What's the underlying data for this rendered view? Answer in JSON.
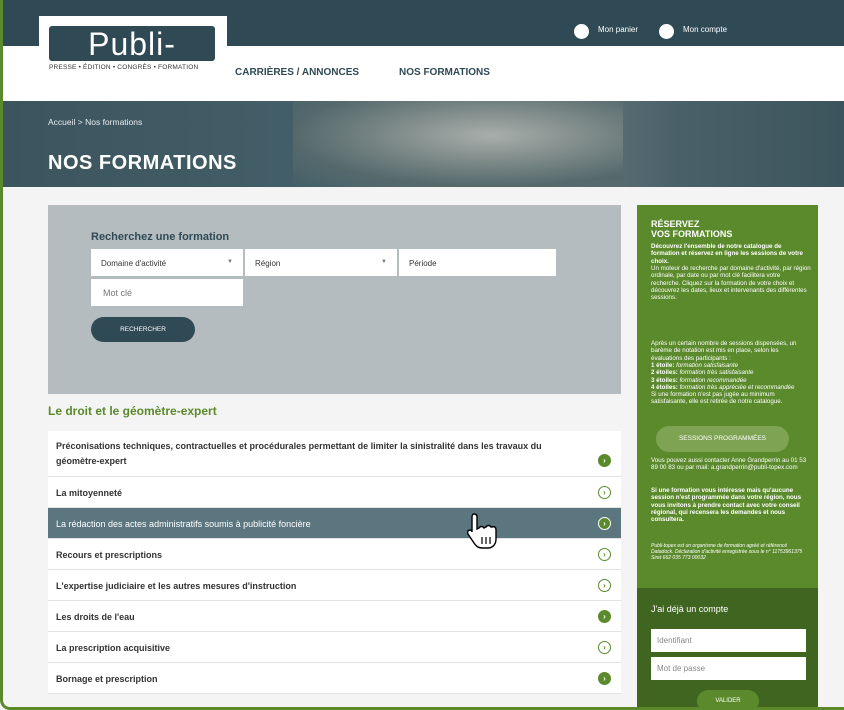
{
  "brand": {
    "logo_text": "Publi-Topex",
    "logo_tagline": "PRESSE • ÉDITION • CONGRÈS • FORMATION"
  },
  "topbar": {
    "cart_label": "Mon panier",
    "account_label": "Mon compte"
  },
  "nav": {
    "item1": "CARRIÈRES / ANNONCES",
    "item2": "NOS FORMATIONS"
  },
  "hero": {
    "breadcrumb": "Accueil > Nos formations",
    "title": "NOS FORMATIONS"
  },
  "search": {
    "title": "Recherchez une formation",
    "domain_select": "Domaine d'activité",
    "region_select": "Région",
    "period_input": "Période",
    "keyword_placeholder": "Mot clé",
    "button": "RECHERCHER"
  },
  "section_title": "Le droit et le géomètre-expert",
  "formations": [
    {
      "line1": "Préconisations techniques, contractuelles et procédurales permettant de limiter la sinistralité dans les travaux du",
      "line2": "géomètre-expert"
    },
    {
      "line1": "La mitoyenneté"
    },
    {
      "line1": "La rédaction des actes administratifs soumis à publicité foncière"
    },
    {
      "line1": "Recours et prescriptions"
    },
    {
      "line1": "L'expertise judiciaire et les autres mesures d'instruction"
    },
    {
      "line1": "Les droits de l'eau"
    },
    {
      "line1": "La prescription acquisitive"
    },
    {
      "line1": "Bornage et prescription"
    }
  ],
  "sidebar": {
    "title1": "RÉSERVEZ",
    "title2": "VOS FORMATIONS",
    "intro_bold": "Découvrez l'ensemble de notre catalogue de formation et réservez en ligne les sessions de votre choix.",
    "intro": "Un moteur de recherche par domaine d'activité, par région ordinale, par date ou par mot clé facilitera votre recherche. Cliquez sur la formation de votre choix et découvrez les dates, lieux et intervenants des différentes sessions.",
    "rating_intro": "Après un certain nombre de sessions dispensées, un barème de notation est mis en place, selon les évaluations des participants :",
    "r1_label": "1 étoile:",
    "r1_text": "formation satisfaisante",
    "r2_label": "2 étoiles:",
    "r2_text": "formation très satisfaisante",
    "r3_label": "3 étoiles:",
    "r3_text": "formation recommandée",
    "r4_label": "4 étoiles:",
    "r4_text": "formation très appréciée et recommandée",
    "rating_outro": "Si une formation n'est pas jugée au minimum satisfaisante, elle est retirée de notre catalogue.",
    "sessions_button": "SESSIONS PROGRAMMÉES",
    "contact": "Vous pouvez aussi contacter Anne Grandperrin au 01 53 89 00 83 ou par mail: a.grandperrin@publi-topex.com",
    "no_session_bold": "Si une formation vous intéresse mais qu'aucune session n'est programmée dans votre région, nous vous invitons à prendre contact avec votre conseil régional, qui recensera les demandes et nous consultera.",
    "legal": "Publi-topex est un organisme de formation agréé et référencé Datadock. Déclaration d'activité enregistrée sous le n° 11753961375 Siret 662 035 773 00032"
  },
  "login": {
    "title": "J'ai déjà un compte",
    "id_placeholder": "Identifiant",
    "pwd_placeholder": "Mot de passe",
    "button": "VALIDER"
  },
  "colors": {
    "dark": "#2f4a55",
    "green": "#5b8a2c",
    "highlight": "#5c7680"
  }
}
